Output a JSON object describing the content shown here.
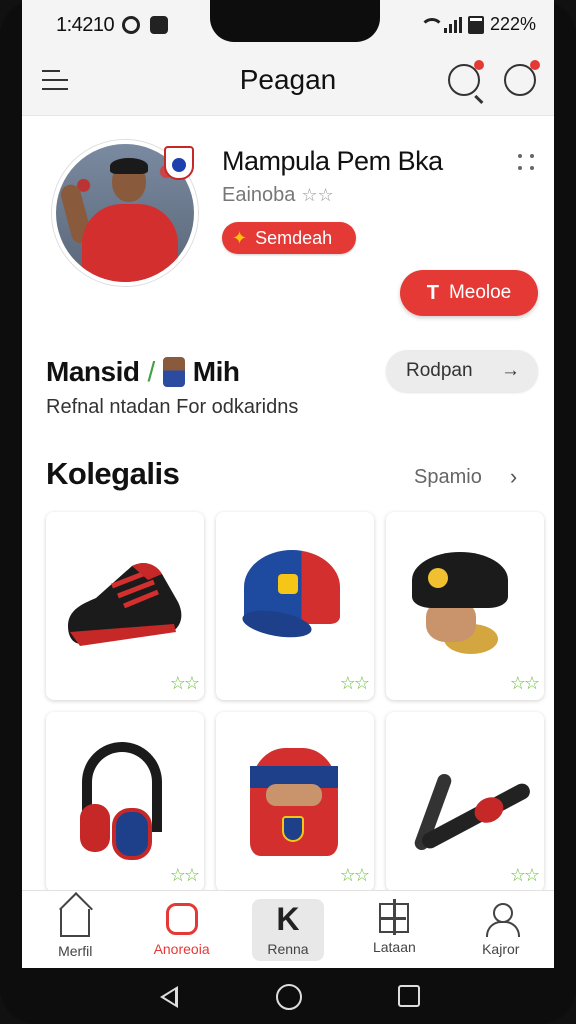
{
  "status": {
    "time": "1:4210",
    "battery": "222%"
  },
  "header": {
    "title": "Peagan",
    "menu_icon": "menu-icon",
    "search_icon": "search-icon",
    "notification_icon": "notification-icon",
    "badge_color": "#e53935"
  },
  "profile": {
    "name": "Mampula Pem Bka",
    "subtitle": "Eainoba",
    "tag_label": "Semdeah",
    "follow_label": "Meoloe",
    "accent": "#e53935"
  },
  "section": {
    "title": "Mansid",
    "title_suffix": "Mih",
    "subtitle": "Refnal ntadan  For odkaridns",
    "pill_label": "Rodpan"
  },
  "collection": {
    "title": "Kolegalis",
    "link_label": "Spamio",
    "items": [
      {
        "icon": "shoe-icon",
        "rating": "☆☆"
      },
      {
        "icon": "cap-icon",
        "rating": "☆☆"
      },
      {
        "icon": "hat-icon",
        "rating": "☆☆"
      },
      {
        "icon": "headphones-icon",
        "rating": "☆☆"
      },
      {
        "icon": "mask-icon",
        "rating": "☆☆"
      },
      {
        "icon": "horn-icon",
        "rating": "☆☆"
      }
    ]
  },
  "nav": {
    "items": [
      {
        "label": "Merfil",
        "icon": "home-icon"
      },
      {
        "label": "Anoreoia",
        "icon": "ring-icon",
        "active": true
      },
      {
        "label": "Renna",
        "icon": "k-icon"
      },
      {
        "label": "Lataan",
        "icon": "grid-icon"
      },
      {
        "label": "Kajror",
        "icon": "user-icon"
      }
    ]
  }
}
